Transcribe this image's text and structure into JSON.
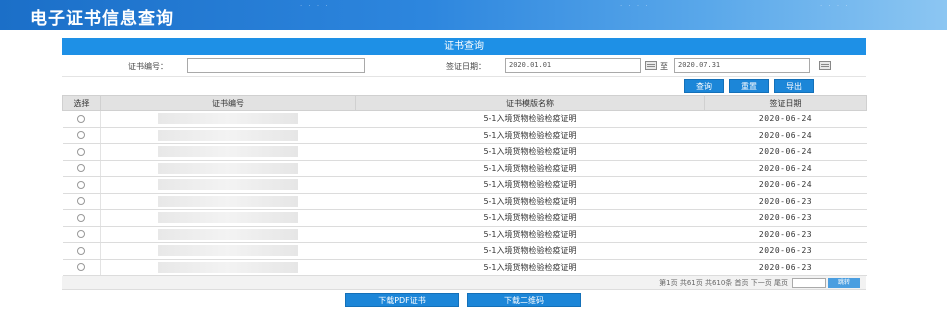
{
  "banner": {
    "title": "电子证书信息查询"
  },
  "panel": {
    "title": "证书查询"
  },
  "criteria": {
    "cert_no_label": "证书编号：",
    "cert_no_value": "",
    "sign_date_label": "签证日期：",
    "date_from": "2020.01.01",
    "date_to_label": "至",
    "date_to": "2020.07.31"
  },
  "buttons": {
    "query": "查询",
    "reset": "重置",
    "export": "导出"
  },
  "table": {
    "headers": [
      "选择",
      "证书编号",
      "证书模版名称",
      "签证日期"
    ],
    "rows": [
      {
        "name": "5-1入境货物检验检疫证明",
        "date": "2020-06-24"
      },
      {
        "name": "5-1入境货物检验检疫证明",
        "date": "2020-06-24"
      },
      {
        "name": "5-1入境货物检验检疫证明",
        "date": "2020-06-24"
      },
      {
        "name": "5-1入境货物检验检疫证明",
        "date": "2020-06-24"
      },
      {
        "name": "5-1入境货物检验检疫证明",
        "date": "2020-06-24"
      },
      {
        "name": "5-1入境货物检验检疫证明",
        "date": "2020-06-23"
      },
      {
        "name": "5-1入境货物检验检疫证明",
        "date": "2020-06-23"
      },
      {
        "name": "5-1入境货物检验检疫证明",
        "date": "2020-06-23"
      },
      {
        "name": "5-1入境货物检验检疫证明",
        "date": "2020-06-23"
      },
      {
        "name": "5-1入境货物检验检疫证明",
        "date": "2020-06-23"
      }
    ]
  },
  "pager": {
    "text": "第1页 共61页 共610条 首页 下一页 尾页",
    "go": "跳转"
  },
  "download": {
    "pdf": "下载PDF证书",
    "qrcode": "下载二维码"
  }
}
